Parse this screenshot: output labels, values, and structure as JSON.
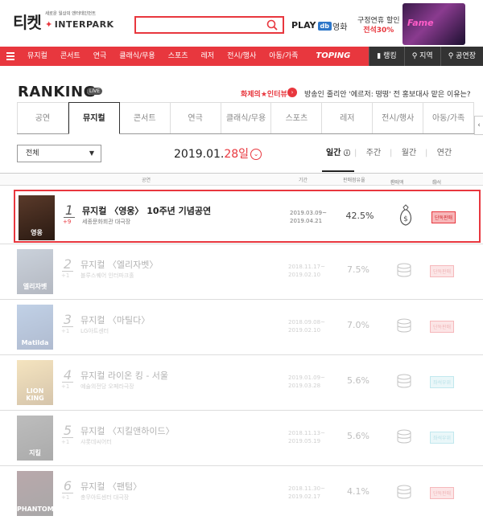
{
  "header": {
    "logo_text": "티켓",
    "logo_tagline": "새로운 일상의 엔터테인먼트",
    "logo_brand": "INTERPARK",
    "play_label": "PLAY",
    "play_badge": "db",
    "movie_link": "영화",
    "promo_line1": "구정연휴 할인",
    "promo_line2": "전석30%",
    "promo_image_text": "Fame"
  },
  "nav": {
    "items": [
      "뮤지컬",
      "콘서트",
      "연극",
      "클래식/무용",
      "스포츠",
      "레저",
      "전시/행사",
      "아동/가족"
    ],
    "toping": "TOPING",
    "right_items": [
      "랭킹",
      "지역",
      "공연장"
    ]
  },
  "ranking": {
    "title": "RANKING",
    "live": "LIVE",
    "hot_label": "화제의★인터뷰",
    "hot_text": "방송인 줄리안 '에르저: 떵떵' 전 홍보대사 맡은 이유는?"
  },
  "genre_tabs": [
    "공연",
    "뮤지컬",
    "콘서트",
    "연극",
    "클래식/무용",
    "스포츠",
    "레저",
    "전시/행사",
    "아동/가족"
  ],
  "active_genre": "뮤지컬",
  "filter": {
    "select_value": "전체",
    "date_prefix": "2019.01.",
    "date_day": "28일",
    "period_tabs": [
      "일간",
      "주간",
      "월간",
      "연간"
    ],
    "active_period": "일간"
  },
  "table_headers": {
    "show": "공연",
    "period": "기간",
    "share": "판매점유율",
    "sales_amount": "판매액",
    "seat": "좌석"
  },
  "rows": [
    {
      "rank": "1",
      "change": "+9",
      "title": "뮤지컬 〈영웅〉 10주년 기념공연",
      "venue": "세종문화회관 대극장",
      "period_start": "2019.03.09~",
      "period_end": "2019.04.21",
      "share": "42.5%",
      "badge": "단독판매",
      "badge_color": "red",
      "poster_text": "영웅",
      "poster_colors": [
        "#5a3a2a",
        "#2a1a12"
      ]
    },
    {
      "rank": "2",
      "change": "+1",
      "title": "뮤지컬 〈엘리자벳〉",
      "venue": "블루스퀘어 인터파크홀",
      "period_start": "2018.11.17~",
      "period_end": "2019.02.10",
      "share": "7.5%",
      "badge": "단독판매",
      "badge_color": "red",
      "poster_text": "엘리자벳",
      "poster_colors": [
        "#6a7f9a",
        "#2a3650"
      ]
    },
    {
      "rank": "3",
      "change": "+1",
      "title": "뮤지컬 〈마틸다〉",
      "venue": "LG아트센터",
      "period_start": "2018.09.08~",
      "period_end": "2019.02.10",
      "share": "7.0%",
      "badge": "단독판매",
      "badge_color": "red",
      "poster_text": "Matilda",
      "poster_colors": [
        "#4f7dba",
        "#1f3f7a"
      ]
    },
    {
      "rank": "4",
      "change": "+1",
      "title": "뮤지컬 라이온 킹 - 서울",
      "venue": "예술의전당 오페라극장",
      "period_start": "2019.01.09~",
      "period_end": "2019.03.28",
      "share": "5.6%",
      "badge": "좌석우위",
      "badge_color": "blue",
      "poster_text": "LION KING",
      "poster_colors": [
        "#e3b34a",
        "#8a5a12"
      ]
    },
    {
      "rank": "5",
      "change": "+1",
      "title": "뮤지컬 〈지킬앤하이드〉",
      "venue": "샤롯데씨어터",
      "period_start": "2018.11.13~",
      "period_end": "2019.05.19",
      "share": "5.6%",
      "badge": "좌석우위",
      "badge_color": "blue",
      "poster_text": "지킬",
      "poster_colors": [
        "#444",
        "#111"
      ]
    },
    {
      "rank": "6",
      "change": "+1",
      "title": "뮤지컬 〈팬텀〉",
      "venue": "충무아트센터 대극장",
      "period_start": "2018.11.30~",
      "period_end": "2019.02.17",
      "share": "4.1%",
      "badge": "단독판매",
      "badge_color": "red",
      "poster_text": "PHANTOM",
      "poster_colors": [
        "#3a0a12",
        "#0a0a0a"
      ]
    }
  ]
}
